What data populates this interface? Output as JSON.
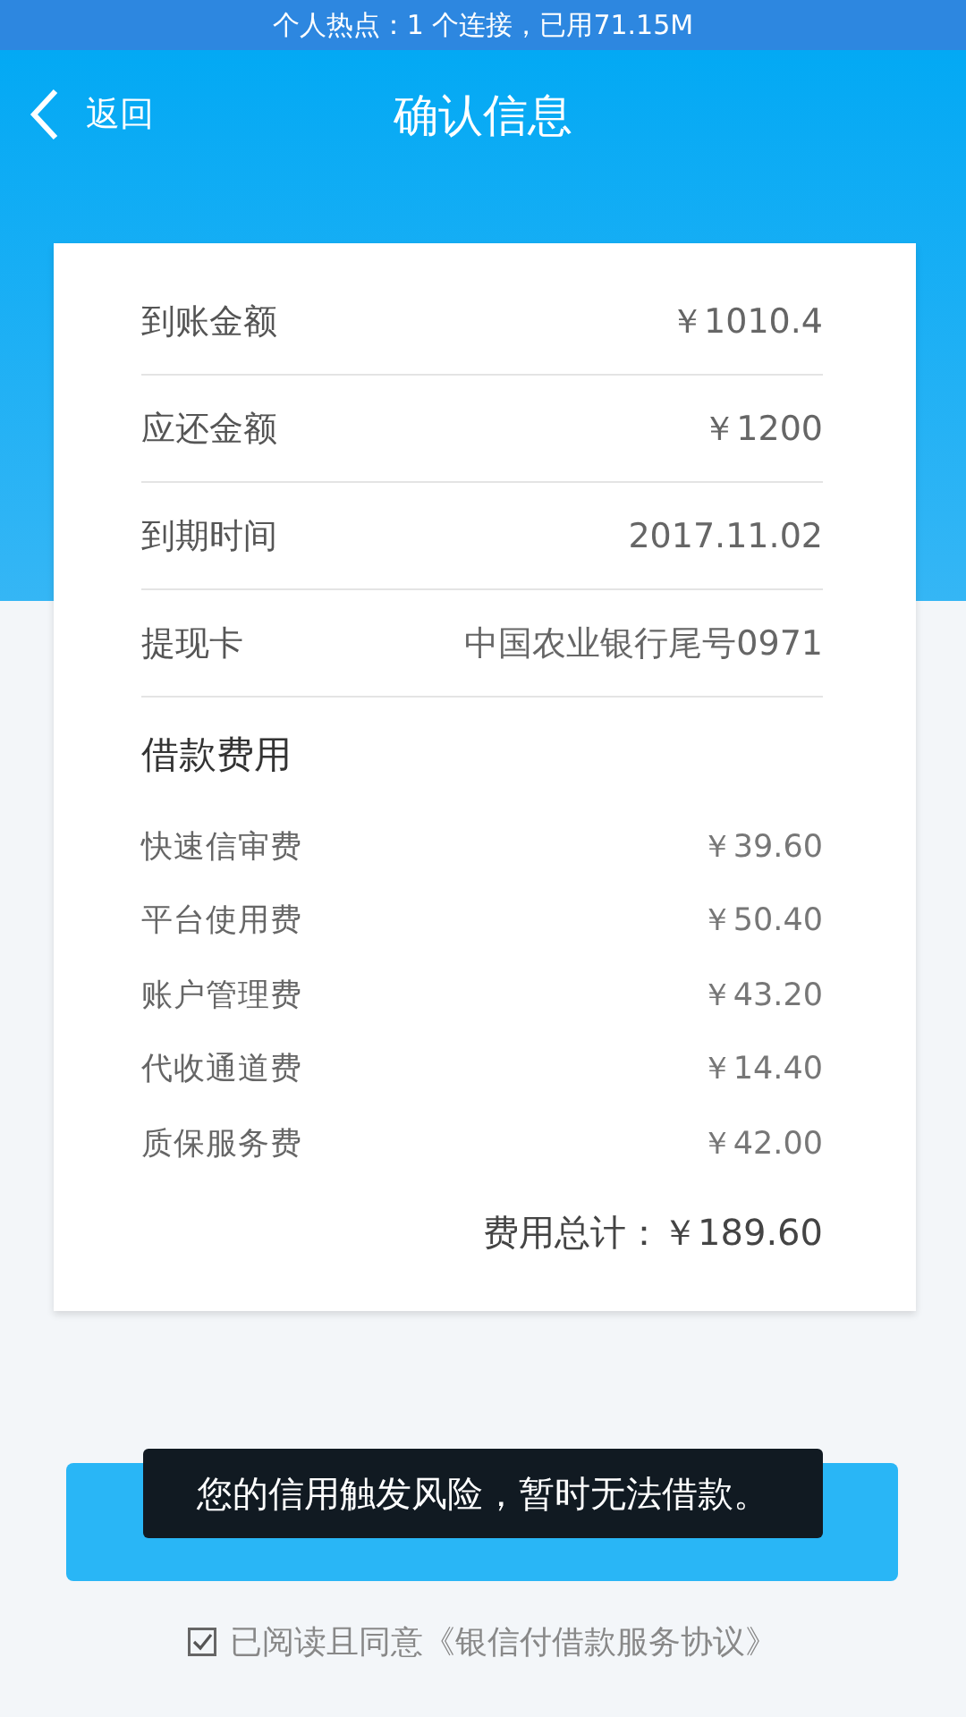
{
  "status_bar": {
    "text": "个人热点：1 个连接，已用71.15M"
  },
  "header": {
    "back_label": "返回",
    "title": "确认信息"
  },
  "summary": [
    {
      "label": "到账金额",
      "value": "￥1010.4"
    },
    {
      "label": "应还金额",
      "value": "￥1200"
    },
    {
      "label": "到期时间",
      "value": "2017.11.02"
    },
    {
      "label": "提现卡",
      "value": "中国农业银行尾号0971"
    }
  ],
  "fees": {
    "title": "借款费用",
    "items": [
      {
        "label": "快速信审费",
        "value": "￥39.60"
      },
      {
        "label": "平台使用费",
        "value": "￥50.40"
      },
      {
        "label": "账户管理费",
        "value": "￥43.20"
      },
      {
        "label": "代收通道费",
        "value": "￥14.40"
      },
      {
        "label": "质保服务费",
        "value": "￥42.00"
      }
    ],
    "total": "费用总计：￥189.60"
  },
  "toast": "您的信用触发风险，暂时无法借款。",
  "agreement": {
    "checked": true,
    "text": "已阅读且同意《银信付借款服务协议》"
  }
}
